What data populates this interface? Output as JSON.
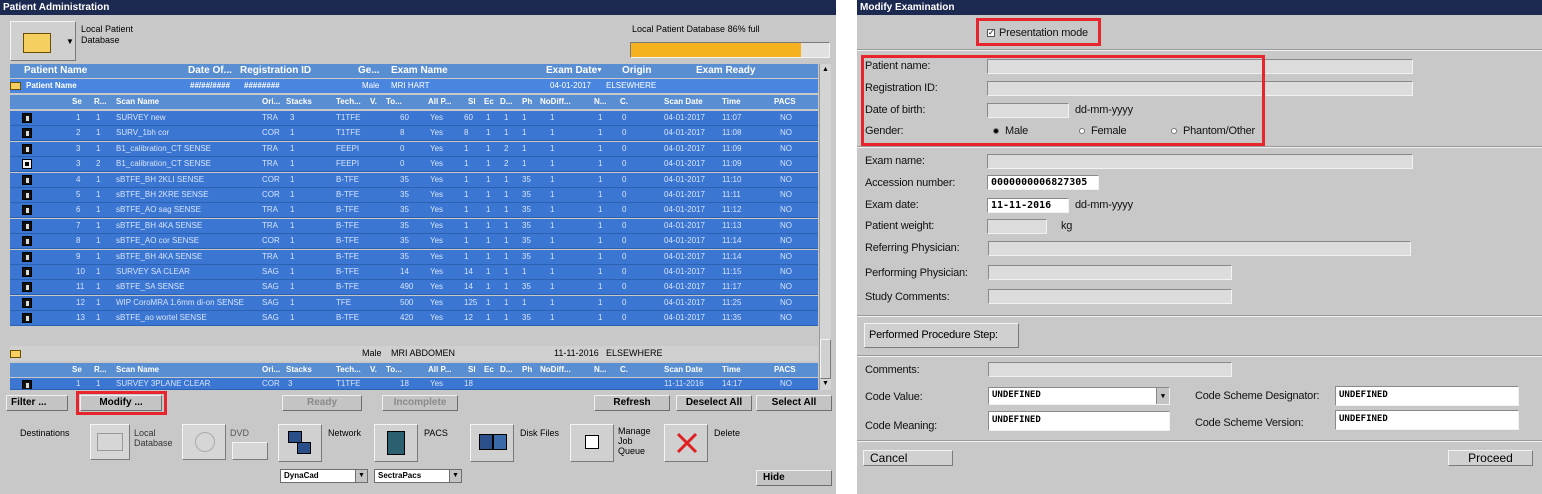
{
  "left": {
    "title": "Patient Administration",
    "source": {
      "label_line1": "Local Patient",
      "label_line2": "Database"
    },
    "db_status": "Local Patient Database 86% full",
    "db_fill": 0.86,
    "columns": {
      "patient_name": "Patient Name",
      "date_of_birth": "Date Of...",
      "registration_id": "Registration ID",
      "gender": "Ge...",
      "exam_name": "Exam Name",
      "exam_date": "Exam Date",
      "origin": "Origin",
      "exam_ready": "Exam Ready"
    },
    "patient_row": {
      "name": "Patient Name",
      "dob": "##/##/####",
      "reg": "########",
      "exam1": {
        "gender": "Male",
        "exam": "MRI HART",
        "date": "04-01-2017",
        "origin": "ELSEWHERE"
      },
      "exam2": {
        "gender": "Male",
        "exam": "MRI ABDOMEN",
        "date": "11-11-2016",
        "origin": "ELSEWHERE"
      }
    },
    "sub_columns": {
      "se": "Se",
      "r": "R...",
      "scan_name": "Scan Name",
      "ori": "Ori...",
      "stacks": "Stacks",
      "tech": "Tech...",
      "v": "V.",
      "to": "To...",
      "allp": "All P...",
      "sl": "Sl",
      "ec": "Ec",
      "d": "D...",
      "ph": "Ph",
      "nodiff": "NoDiff...",
      "n": "N...",
      "c": "C.",
      "scan_date": "Scan Date",
      "time": "Time",
      "pacs": "PACS"
    },
    "scans": [
      {
        "se": "1",
        "r": "1",
        "name": "SURVEY new",
        "ori": "TRA",
        "stacks": "3",
        "tech": "T1TFE",
        "to": "60",
        "allp": "Yes",
        "sl": "60",
        "ec": "1",
        "d": "1",
        "ph": "1",
        "nodiff": "1",
        "n": "1",
        "c": "0",
        "date": "04-01-2017",
        "time": "11:07",
        "pacs": "NO",
        "icon": "dark"
      },
      {
        "se": "2",
        "r": "1",
        "name": "SURV_1bh cor",
        "ori": "COR",
        "stacks": "1",
        "tech": "T1TFE",
        "to": "8",
        "allp": "Yes",
        "sl": "8",
        "ec": "1",
        "d": "1",
        "ph": "1",
        "nodiff": "1",
        "n": "1",
        "c": "0",
        "date": "04-01-2017",
        "time": "11:08",
        "pacs": "NO",
        "icon": "dark"
      },
      {
        "se": "3",
        "r": "1",
        "name": "B1_calibration_CT SENSE",
        "ori": "TRA",
        "stacks": "1",
        "tech": "FEEPI",
        "to": "0",
        "allp": "Yes",
        "sl": "1",
        "ec": "1",
        "d": "2",
        "ph": "1",
        "nodiff": "1",
        "n": "1",
        "c": "0",
        "date": "04-01-2017",
        "time": "11:09",
        "pacs": "NO",
        "icon": "dark"
      },
      {
        "se": "3",
        "r": "2",
        "name": "B1_calibration_CT SENSE",
        "ori": "TRA",
        "stacks": "1",
        "tech": "FEEPI",
        "to": "0",
        "allp": "Yes",
        "sl": "1",
        "ec": "1",
        "d": "2",
        "ph": "1",
        "nodiff": "1",
        "n": "1",
        "c": "0",
        "date": "04-01-2017",
        "time": "11:09",
        "pacs": "NO",
        "icon": "light"
      },
      {
        "se": "4",
        "r": "1",
        "name": "sBTFE_BH 2KLI SENSE",
        "ori": "COR",
        "stacks": "1",
        "tech": "B-TFE",
        "to": "35",
        "allp": "Yes",
        "sl": "1",
        "ec": "1",
        "d": "1",
        "ph": "35",
        "nodiff": "1",
        "n": "1",
        "c": "0",
        "date": "04-01-2017",
        "time": "11:10",
        "pacs": "NO",
        "icon": "dark"
      },
      {
        "se": "5",
        "r": "1",
        "name": "sBTFE_BH 2KRE SENSE",
        "ori": "COR",
        "stacks": "1",
        "tech": "B-TFE",
        "to": "35",
        "allp": "Yes",
        "sl": "1",
        "ec": "1",
        "d": "1",
        "ph": "35",
        "nodiff": "1",
        "n": "1",
        "c": "0",
        "date": "04-01-2017",
        "time": "11:11",
        "pacs": "NO",
        "icon": "dark"
      },
      {
        "se": "6",
        "r": "1",
        "name": "sBTFE_AO sag SENSE",
        "ori": "TRA",
        "stacks": "1",
        "tech": "B-TFE",
        "to": "35",
        "allp": "Yes",
        "sl": "1",
        "ec": "1",
        "d": "1",
        "ph": "35",
        "nodiff": "1",
        "n": "1",
        "c": "0",
        "date": "04-01-2017",
        "time": "11:12",
        "pacs": "NO",
        "icon": "dark"
      },
      {
        "se": "7",
        "r": "1",
        "name": "sBTFE_BH 4KA SENSE",
        "ori": "TRA",
        "stacks": "1",
        "tech": "B-TFE",
        "to": "35",
        "allp": "Yes",
        "sl": "1",
        "ec": "1",
        "d": "1",
        "ph": "35",
        "nodiff": "1",
        "n": "1",
        "c": "0",
        "date": "04-01-2017",
        "time": "11:13",
        "pacs": "NO",
        "icon": "dark"
      },
      {
        "se": "8",
        "r": "1",
        "name": "sBTFE_AO cor SENSE",
        "ori": "COR",
        "stacks": "1",
        "tech": "B-TFE",
        "to": "35",
        "allp": "Yes",
        "sl": "1",
        "ec": "1",
        "d": "1",
        "ph": "35",
        "nodiff": "1",
        "n": "1",
        "c": "0",
        "date": "04-01-2017",
        "time": "11:14",
        "pacs": "NO",
        "icon": "dark"
      },
      {
        "se": "9",
        "r": "1",
        "name": "sBTFE_BH 4KA SENSE",
        "ori": "TRA",
        "stacks": "1",
        "tech": "B-TFE",
        "to": "35",
        "allp": "Yes",
        "sl": "1",
        "ec": "1",
        "d": "1",
        "ph": "35",
        "nodiff": "1",
        "n": "1",
        "c": "0",
        "date": "04-01-2017",
        "time": "11:14",
        "pacs": "NO",
        "icon": "dark"
      },
      {
        "se": "10",
        "r": "1",
        "name": "SURVEY SA CLEAR",
        "ori": "SAG",
        "stacks": "1",
        "tech": "B-TFE",
        "to": "14",
        "allp": "Yes",
        "sl": "14",
        "ec": "1",
        "d": "1",
        "ph": "1",
        "nodiff": "1",
        "n": "1",
        "c": "0",
        "date": "04-01-2017",
        "time": "11:15",
        "pacs": "NO",
        "icon": "dark"
      },
      {
        "se": "11",
        "r": "1",
        "name": "sBTFE_SA SENSE",
        "ori": "SAG",
        "stacks": "1",
        "tech": "B-TFE",
        "to": "490",
        "allp": "Yes",
        "sl": "14",
        "ec": "1",
        "d": "1",
        "ph": "35",
        "nodiff": "1",
        "n": "1",
        "c": "0",
        "date": "04-01-2017",
        "time": "11:17",
        "pacs": "NO",
        "icon": "dark"
      },
      {
        "se": "12",
        "r": "1",
        "name": "WIP CoroMRA 1.6mm di-on SENSE",
        "ori": "SAG",
        "stacks": "1",
        "tech": "TFE",
        "to": "500",
        "allp": "Yes",
        "sl": "125",
        "ec": "1",
        "d": "1",
        "ph": "1",
        "nodiff": "1",
        "n": "1",
        "c": "0",
        "date": "04-01-2017",
        "time": "11:25",
        "pacs": "NO",
        "icon": "dark"
      },
      {
        "se": "13",
        "r": "1",
        "name": "sBTFE_ao wortel SENSE",
        "ori": "SAG",
        "stacks": "1",
        "tech": "B-TFE",
        "to": "420",
        "allp": "Yes",
        "sl": "12",
        "ec": "1",
        "d": "1",
        "ph": "35",
        "nodiff": "1",
        "n": "1",
        "c": "0",
        "date": "04-01-2017",
        "time": "11:35",
        "pacs": "NO",
        "icon": "dark"
      }
    ],
    "partial_scan": {
      "se": "1",
      "r": "1",
      "name": "SURVEY 3PLANE CLEAR",
      "ori": "COR",
      "stacks": "3",
      "tech": "T1TFE",
      "to": "18",
      "allp": "Yes",
      "sl": "18",
      "ec": "1",
      "d": "1",
      "ph": "1",
      "nodiff": "1",
      "n": "1",
      "c": "0",
      "date": "11-11-2016",
      "time": "14:17",
      "pacs": "NO"
    },
    "buttons": {
      "filter": "Filter ...",
      "modify": "Modify ...",
      "ready": "Ready",
      "incomplete": "Incomplete",
      "refresh": "Refresh",
      "deselect_all": "Deselect All",
      "select_all": "Select All",
      "hide": "Hide"
    },
    "destinations": {
      "label": "Destinations",
      "local_db_line1": "Local",
      "local_db_line2": "Database",
      "dvd": "DVD",
      "network": "Network",
      "network_value": "DynaCad",
      "pacs": "PACS",
      "pacs_value": "SectraPacs",
      "disk_files": "Disk Files",
      "manage_line1": "Manage",
      "manage_line2": "Job",
      "manage_line3": "Queue",
      "delete": "Delete"
    }
  },
  "right": {
    "title": "Modify Examination",
    "presentation_mode": "Presentation mode",
    "patient_name_label": "Patient name:",
    "registration_id_label": "Registration ID:",
    "dob_label": "Date of birth:",
    "dob_format": "dd-mm-yyyy",
    "gender_label": "Gender:",
    "gender_options": [
      "Male",
      "Female",
      "Phantom/Other"
    ],
    "exam_name_label": "Exam name:",
    "accession_label": "Accession number:",
    "accession_value": "0000000006827305",
    "exam_date_label": "Exam date:",
    "exam_date_value": "11-11-2016",
    "exam_date_format": "dd-mm-yyyy",
    "weight_label": "Patient weight:",
    "weight_unit": "kg",
    "referring_label": "Referring Physician:",
    "performing_label": "Performing Physician:",
    "study_comments_label": "Study Comments:",
    "pps_button": "Performed Procedure Step:",
    "comments_label": "Comments:",
    "code_value_label": "Code Value:",
    "code_value": "UNDEFINED",
    "code_meaning_label": "Code Meaning:",
    "code_meaning": "UNDEFINED",
    "csd_label": "Code Scheme Designator:",
    "csd_value": "UNDEFINED",
    "csv_label": "Code Scheme Version:",
    "csv_value": "UNDEFINED",
    "cancel": "Cancel",
    "proceed": "Proceed"
  },
  "colors": {
    "highlight": "#e8242c",
    "title_bar": "#1c2a52",
    "row_blue": "#3a76d2",
    "header_blue": "#5a8ed3",
    "db_fill": "#f5b21e"
  }
}
